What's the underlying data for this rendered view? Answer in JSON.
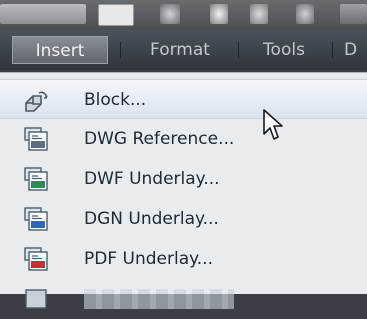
{
  "menubar": {
    "items": [
      {
        "label": "Insert",
        "active": true
      },
      {
        "label": "Format",
        "active": false
      },
      {
        "label": "Tools",
        "active": false
      },
      {
        "label": "D",
        "active": false
      }
    ]
  },
  "dropdown": {
    "items": [
      {
        "label": "Block...",
        "icon": "block-icon",
        "hovered": true
      },
      {
        "label": "DWG Reference...",
        "icon": "dwg-reference-icon"
      },
      {
        "label": "DWF Underlay...",
        "icon": "dwf-underlay-icon"
      },
      {
        "label": "DGN Underlay...",
        "icon": "dgn-underlay-icon"
      },
      {
        "label": "PDF Underlay...",
        "icon": "pdf-underlay-icon"
      }
    ]
  },
  "colors": {
    "menubar_bg": "#2f343a",
    "menu_active_bg": "#8b9096",
    "dropdown_bg": "#e9ecef",
    "hover_bg": "#dbe3ee",
    "dwg_icon": "#5b6f84",
    "dwf_icon": "#2e8b57",
    "dgn_icon": "#2b6cb0",
    "pdf_icon": "#c53030"
  }
}
